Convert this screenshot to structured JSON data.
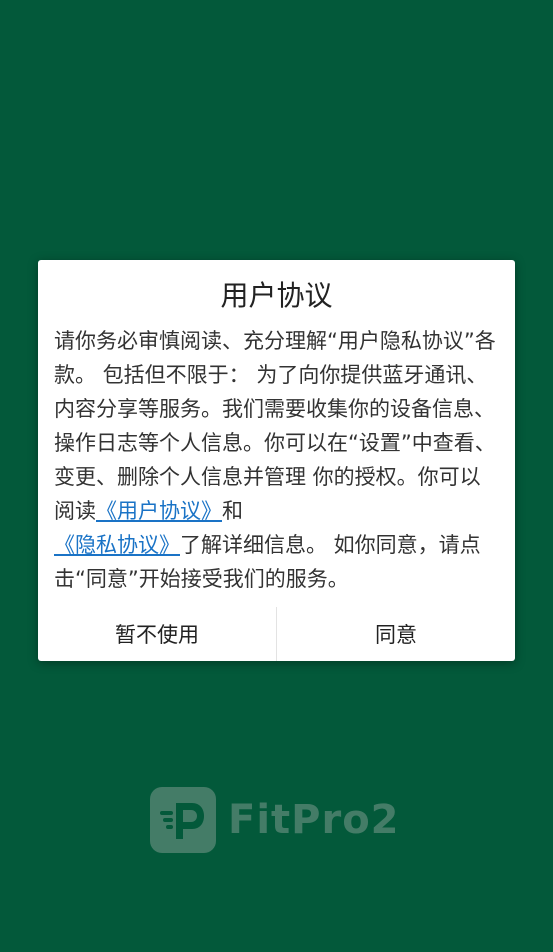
{
  "dialog": {
    "title": "用户协议",
    "body_part1": "请你务必审慎阅读、充分理解“用户隐私协议”各款。 包括但不限于： 为了向你提供蓝牙通讯、内容分享等服务。我们需要收集你的设备信息、 操作日志等个人信息。你可以在“设置”中查看、变更、删除个人信息并管理 你的授权。你可以阅读",
    "user_agreement_link": "《用户协议》",
    "body_and": "和",
    "privacy_policy_link": "《隐私协议》",
    "body_part2": "了解详细信息。 如你同意，请点击“同意”开始接受我们的服务。",
    "decline_label": "暂不使用",
    "agree_label": "同意"
  },
  "background": {
    "color": "#03593a",
    "logo": {
      "icon": "fitpro-logo-icon",
      "text": "FitPro2"
    }
  },
  "colors": {
    "link": "#1a73c6",
    "dialog_bg": "#ffffff"
  }
}
